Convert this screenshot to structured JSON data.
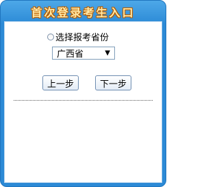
{
  "header": {
    "title": "首次登录考生入口"
  },
  "form": {
    "radio_label": "选择报考省份",
    "province_selected": "广西省",
    "select_arrow_icon": "chevron-down-icon",
    "prev_label": "上一步",
    "next_label": "下一步"
  },
  "colors": {
    "frame_blue": "#2c8ad6",
    "title_text": "#ffe9a8",
    "title_outline": "#b05800"
  }
}
